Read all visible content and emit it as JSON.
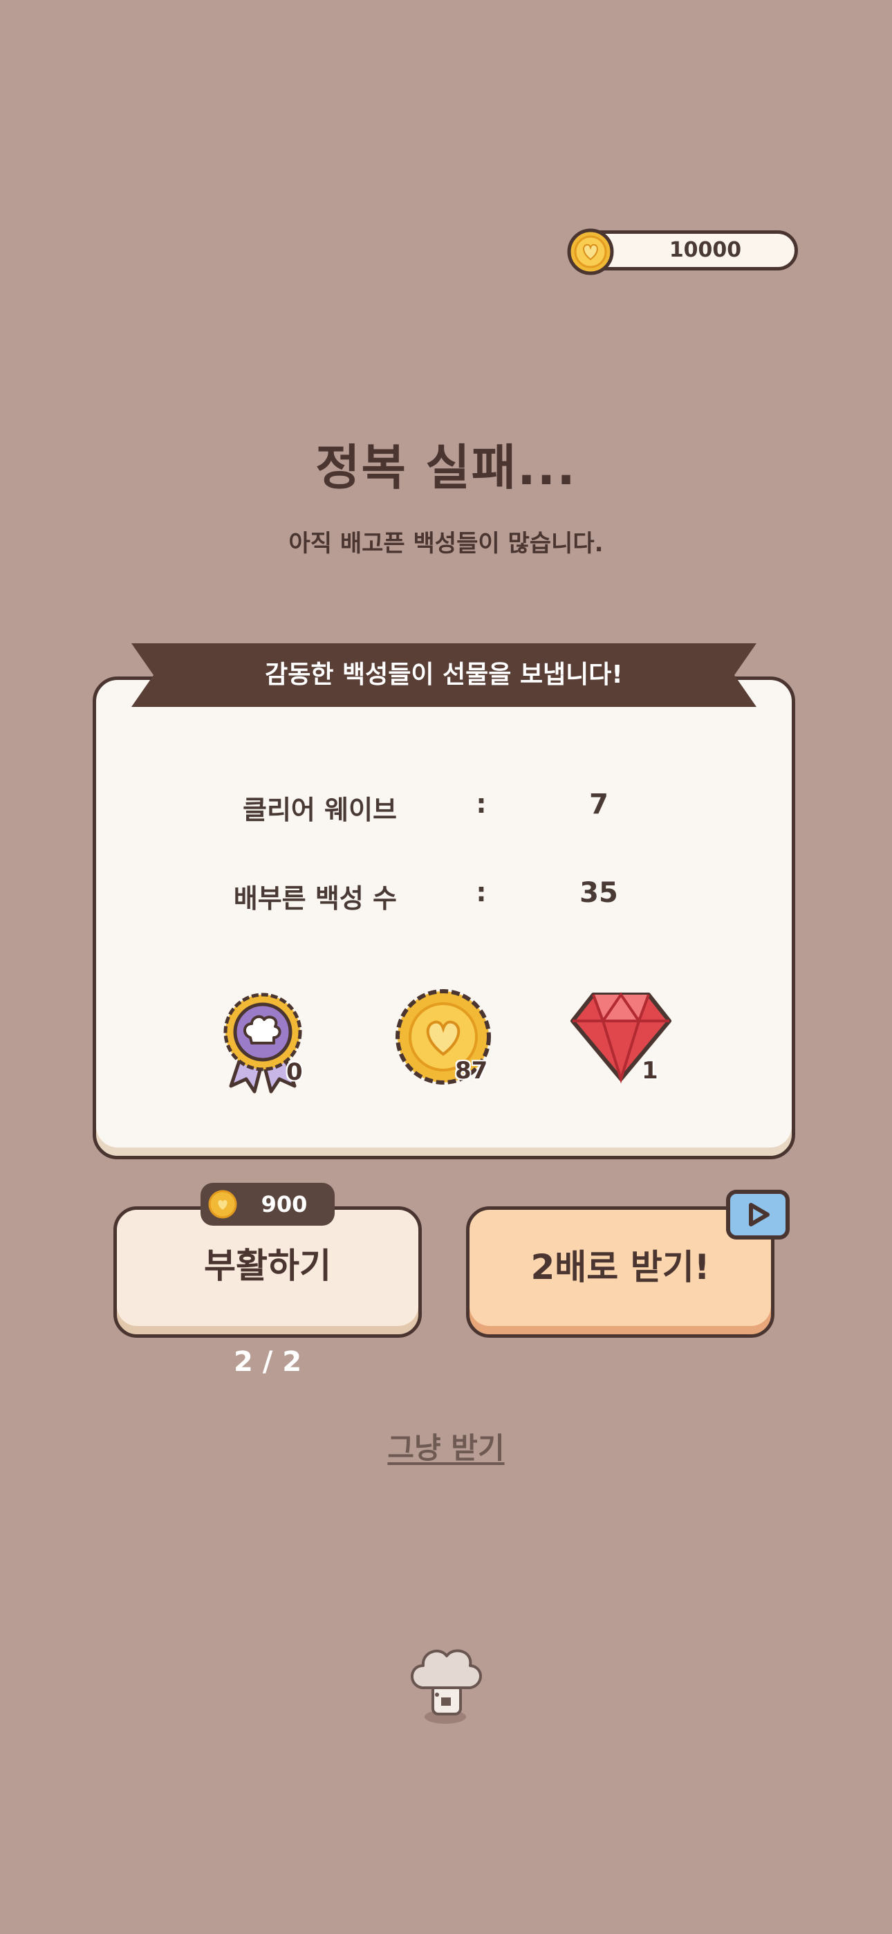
{
  "header": {
    "coin_balance": "10000",
    "coin_icon": "heart-coin-icon"
  },
  "result": {
    "title": "정복 실패...",
    "subtitle": "아직 배고픈 백성들이 많습니다."
  },
  "card": {
    "ribbon_text": "감동한 백성들이 선물을 보냅니다!",
    "stats": [
      {
        "label": "클리어 웨이브",
        "colon": ":",
        "value": "7"
      },
      {
        "label": "배부른 백성 수",
        "colon": ":",
        "value": "35"
      }
    ],
    "rewards": [
      {
        "icon": "chef-badge-icon",
        "count": "0"
      },
      {
        "icon": "heart-coin-icon",
        "count": "87"
      },
      {
        "icon": "ruby-gem-icon",
        "count": "1"
      }
    ]
  },
  "actions": {
    "revive_label": "부활하기",
    "revive_cost": "900",
    "revive_remaining": "2 / 2",
    "double_label": "2배로 받기!",
    "double_icon": "video-ad-icon",
    "just_receive_label": "그냥 받기"
  },
  "colors": {
    "background": "#b79d94",
    "card": "#faf6f1",
    "ribbon": "#5a3f37",
    "revive_button": "#f8eadc",
    "double_button": "#fbd5ad",
    "outline": "#4a3530"
  }
}
